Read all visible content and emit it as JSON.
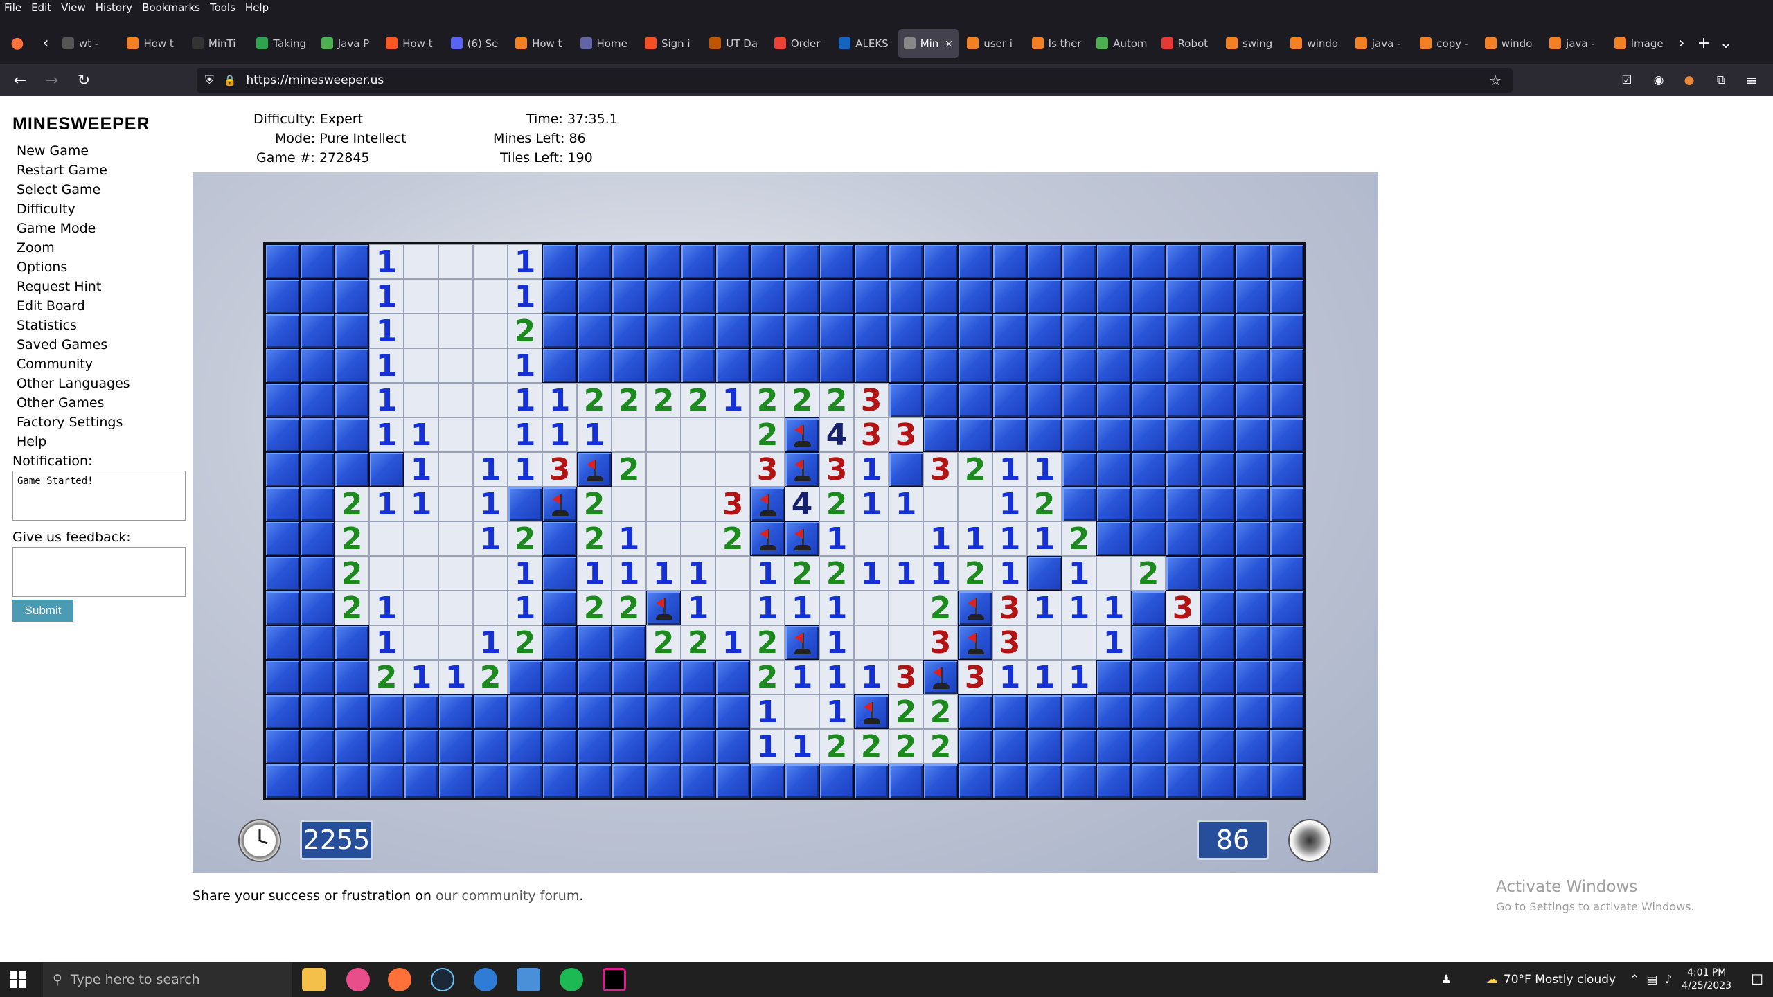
{
  "browser": {
    "menu": [
      "File",
      "Edit",
      "View",
      "History",
      "Bookmarks",
      "Tools",
      "Help"
    ],
    "tabs": [
      {
        "label": "wt -",
        "color": "#555"
      },
      {
        "label": "How t",
        "color": "#f48024"
      },
      {
        "label": "MinTi",
        "color": "#333"
      },
      {
        "label": "Taking",
        "color": "#2ea44f"
      },
      {
        "label": "Java P",
        "color": "#4caf50"
      },
      {
        "label": "How t",
        "color": "#ff5722"
      },
      {
        "label": "(6) Se",
        "color": "#5865f2"
      },
      {
        "label": "How t",
        "color": "#f48024"
      },
      {
        "label": "Home",
        "color": "#6264a7"
      },
      {
        "label": "Sign i",
        "color": "#f25022"
      },
      {
        "label": "UT Da",
        "color": "#bf5700"
      },
      {
        "label": "Order",
        "color": "#ea4335"
      },
      {
        "label": "ALEKS",
        "color": "#1565c0"
      },
      {
        "label": "Min",
        "color": "#888",
        "active": true
      },
      {
        "label": "user i",
        "color": "#f48024"
      },
      {
        "label": "Is ther",
        "color": "#f48024"
      },
      {
        "label": "Autom",
        "color": "#4caf50"
      },
      {
        "label": "Robot",
        "color": "#e53935"
      },
      {
        "label": "swing",
        "color": "#f48024"
      },
      {
        "label": "windo",
        "color": "#f48024"
      },
      {
        "label": "java -",
        "color": "#f48024"
      },
      {
        "label": "copy -",
        "color": "#f48024"
      },
      {
        "label": "windo",
        "color": "#f48024"
      },
      {
        "label": "java -",
        "color": "#f48024"
      },
      {
        "label": "Image",
        "color": "#f48024"
      }
    ],
    "url": "https://minesweeper.us"
  },
  "sidebar": {
    "title": "MINESWEEPER",
    "links": [
      "New Game",
      "Restart Game",
      "Select Game",
      "Difficulty",
      "Game Mode",
      "Zoom",
      "Options",
      "Request Hint",
      "Edit Board",
      "Statistics",
      "Saved Games",
      "Community",
      "Other Languages",
      "Other Games",
      "Factory Settings",
      "Help"
    ],
    "notification_label": "Notification:",
    "notification_text": "Game Started!",
    "feedback_label": "Give us feedback:",
    "submit_label": "Submit"
  },
  "info": {
    "difficulty": "Difficulty: Expert",
    "mode": "Mode: Pure Intellect",
    "game": "Game #: 272845",
    "time": "Time: 37:35.1",
    "mines_left": "Mines Left: 86",
    "tiles_left": "Tiles Left: 190"
  },
  "board": {
    "rows": [
      "HHH1...1HHHHHHHHHHHHHHHHHHHHHH",
      "HHH1...1HHHHHHHHHHHHHHHHHHHHHH",
      "HHH1...2HHHHHHHHHHHHHHHHHHHHHH",
      "HHH1...1HHHHHHHHHHHHHHHHHHHHHH",
      "HHH1...11222212223HHHHHHHHHHHH",
      "HHH11..111....2F433HHHHHHHHHHH",
      "HHHH1.113F2...3F31H3211HHHHHHH",
      "HH211.1HF2...3F4211..12HHHHHHH",
      "HH2...12H21..2FF1..11112HHHHHH",
      "HH2....1H1111.12211121H1.2HHHH",
      "HH21...1H22F1.111..2F3111H3HHH",
      "HHH1..12HHH2212F1..3F3..1HHHHH",
      "HHH2112HHHHHHH21113F3111HHHHHH",
      "HHHHHHHHHHHHHH1.1F22HHHHHHHHHH",
      "HHHHHHHHHHHHHH112222HHHHHHHHHH",
      "HHHHHHHHHHHHHHHHHHHHHHHHHHHHHH"
    ]
  },
  "counters": {
    "timer": "2255",
    "mines": "86"
  },
  "footer": {
    "share_prefix": "Share your success or frustration on ",
    "share_link": "our community forum",
    "share_suffix": "."
  },
  "watermark": {
    "line1": "Activate Windows",
    "line2": "Go to Settings to activate Windows."
  },
  "taskbar": {
    "search_placeholder": "Type here to search",
    "weather": "70°F  Mostly cloudy",
    "time": "4:01 PM",
    "date": "4/25/2023"
  }
}
